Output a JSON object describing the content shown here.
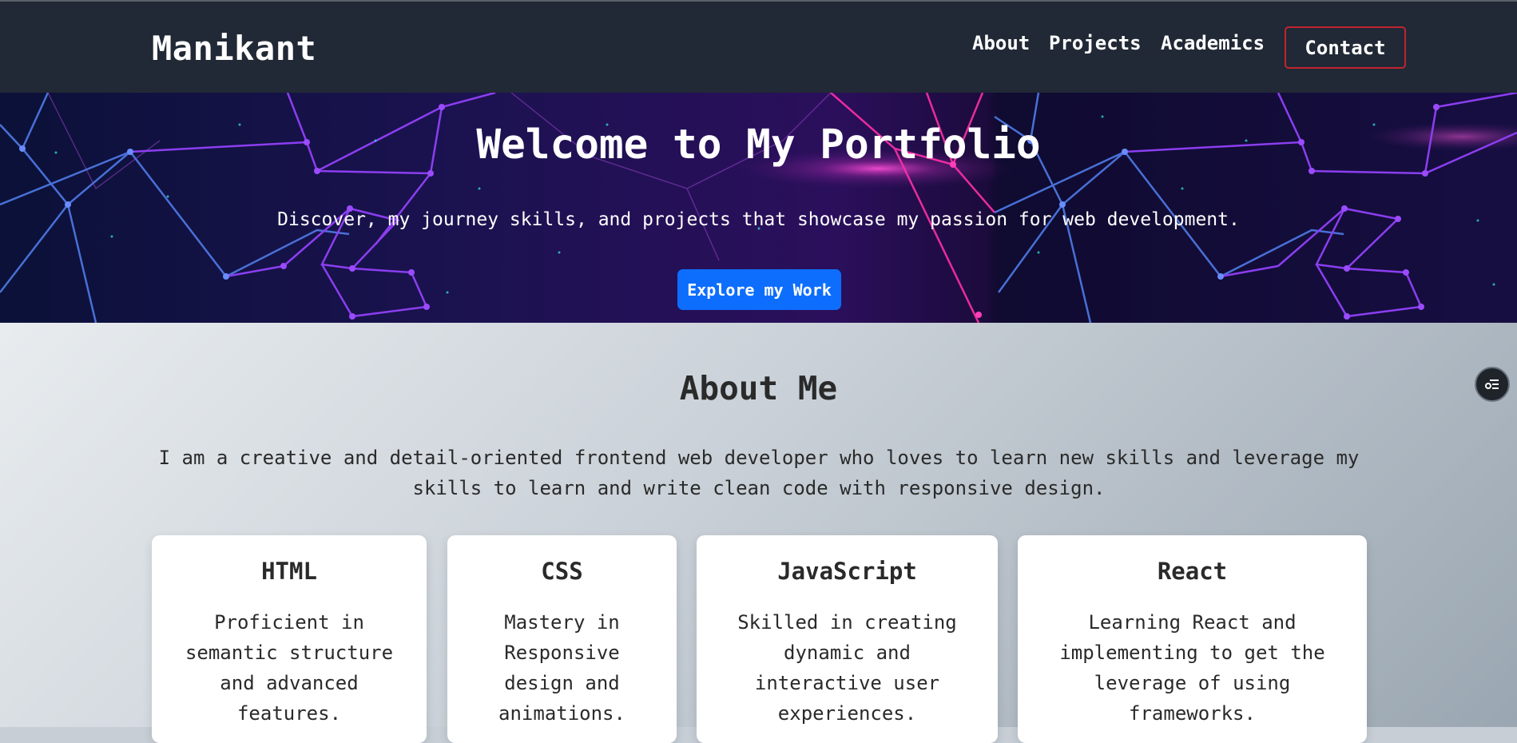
{
  "header": {
    "brand": "Manikant",
    "nav": {
      "about": "About",
      "projects": "Projects",
      "academics": "Academics",
      "contact": "Contact"
    }
  },
  "hero": {
    "title": "Welcome to My Portfolio",
    "subtitle": "Discover, my journey skills, and projects that showcase my passion for web development.",
    "cta": "Explore my Work"
  },
  "about": {
    "title": "About Me",
    "text": "I am a creative and detail-oriented frontend web developer who loves to learn new skills and leverage my skills to learn and write clean code with responsive design.",
    "cards": [
      {
        "title": "HTML",
        "desc": "Proficient in semantic structure and advanced features."
      },
      {
        "title": "CSS",
        "desc": "Mastery in Responsive design and animations."
      },
      {
        "title": "JavaScript",
        "desc": "Skilled in creating dynamic and interactive user experiences."
      },
      {
        "title": "React",
        "desc": "Learning React and implementing to get the leverage of using frameworks."
      }
    ]
  },
  "colors": {
    "navbar": "#212936",
    "accent_button": "#0d6efd",
    "contact_border": "#c0242f"
  },
  "icons": {
    "floating": "accessibility-menu-icon"
  }
}
